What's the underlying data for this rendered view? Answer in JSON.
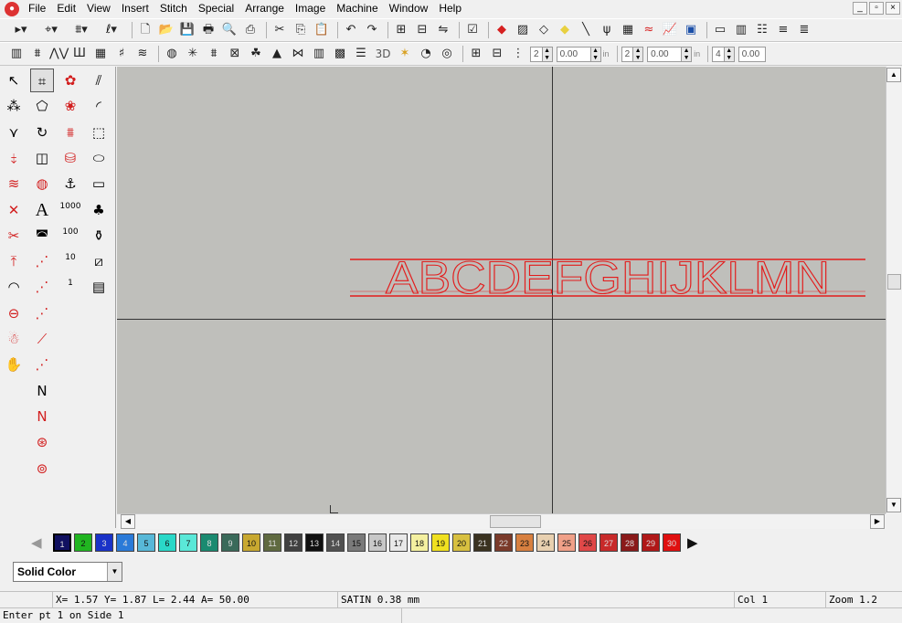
{
  "menubar": {
    "items": [
      "File",
      "Edit",
      "View",
      "Insert",
      "Stitch",
      "Special",
      "Arrange",
      "Image",
      "Machine",
      "Window",
      "Help"
    ]
  },
  "window_controls": {
    "minimize": "_",
    "restore": "▫",
    "close": "×"
  },
  "toolbar1": {
    "tools": [
      {
        "name": "select-mode-icon",
        "glyph": "▸▾"
      },
      {
        "name": "edit-points-icon",
        "glyph": "⌖▾"
      },
      {
        "name": "stitch-mode-icon",
        "glyph": "⩩▾"
      },
      {
        "name": "pen-mode-icon",
        "glyph": "ℓ▾"
      },
      {
        "name": "new-file-icon",
        "glyph": "🗋"
      },
      {
        "name": "open-file-icon",
        "glyph": "📂"
      },
      {
        "name": "save-icon",
        "glyph": "💾"
      },
      {
        "name": "print-icon",
        "glyph": "🖶"
      },
      {
        "name": "print-preview-icon",
        "glyph": "🔍"
      },
      {
        "name": "scan-icon",
        "glyph": "⎙"
      },
      {
        "name": "cut-icon",
        "glyph": "✂"
      },
      {
        "name": "copy-icon",
        "glyph": "⎘"
      },
      {
        "name": "paste-icon",
        "glyph": "📋"
      },
      {
        "name": "undo-icon",
        "glyph": "↶"
      },
      {
        "name": "redo-icon",
        "glyph": "↷"
      },
      {
        "name": "group-icon",
        "glyph": "⊞"
      },
      {
        "name": "ungroup-icon",
        "glyph": "⊟"
      },
      {
        "name": "mirror-icon",
        "glyph": "⇋"
      },
      {
        "name": "checkbox-icon",
        "glyph": "☑"
      },
      {
        "name": "red-fill-icon",
        "glyph": "◆"
      },
      {
        "name": "pattern-fill-icon",
        "glyph": "▨"
      },
      {
        "name": "outline-icon",
        "glyph": "◇"
      },
      {
        "name": "yellow-fill-icon",
        "glyph": "◆"
      },
      {
        "name": "needle-icon",
        "glyph": "╲"
      },
      {
        "name": "satin-icon",
        "glyph": "ψ"
      },
      {
        "name": "grid-icon",
        "glyph": "▦"
      },
      {
        "name": "red-satin-icon",
        "glyph": "≈"
      },
      {
        "name": "chart-icon",
        "glyph": "📈"
      },
      {
        "name": "color-picture-icon",
        "glyph": "▣"
      },
      {
        "name": "monitor-icon",
        "glyph": "▭"
      },
      {
        "name": "columns-icon",
        "glyph": "▥"
      },
      {
        "name": "tree-icon",
        "glyph": "☷"
      },
      {
        "name": "align-left-icon",
        "glyph": "≡"
      },
      {
        "name": "align-right-icon",
        "glyph": "≣"
      }
    ]
  },
  "toolbar2": {
    "stitch_tools": [
      {
        "name": "fill-stitch-icon",
        "glyph": "▥"
      },
      {
        "name": "column-stitch-icon",
        "glyph": "⩩"
      },
      {
        "name": "wave-stitch-icon",
        "glyph": "⋀⋁"
      },
      {
        "name": "satin-column-icon",
        "glyph": "Ш"
      },
      {
        "name": "tatami-icon",
        "glyph": "▦"
      },
      {
        "name": "net-icon",
        "glyph": "♯"
      },
      {
        "name": "motif-icon",
        "glyph": "≋"
      },
      {
        "name": "circle-fill-icon",
        "glyph": "◍"
      },
      {
        "name": "star-fill-icon",
        "glyph": "✳"
      },
      {
        "name": "zigzag-icon",
        "glyph": "⩩"
      },
      {
        "name": "cross-icon",
        "glyph": "⊠"
      },
      {
        "name": "leaf-icon",
        "glyph": "☘"
      },
      {
        "name": "triangle-fill-icon",
        "glyph": "▲"
      },
      {
        "name": "wave-fill-icon",
        "glyph": "⋈"
      },
      {
        "name": "bars-icon",
        "glyph": "▥"
      },
      {
        "name": "block-icon",
        "glyph": "▩"
      },
      {
        "name": "lines-icon",
        "glyph": "☰"
      }
    ],
    "label_3d": "3D",
    "extra_tools": [
      {
        "name": "sparkle-icon",
        "glyph": "✶"
      },
      {
        "name": "shell-icon",
        "glyph": "◔"
      },
      {
        "name": "cup-icon",
        "glyph": "◎"
      },
      {
        "name": "align-grid-icon",
        "glyph": "⊞"
      },
      {
        "name": "align-grid-2-icon",
        "glyph": "⊟"
      },
      {
        "name": "vertical-spacing-icon",
        "glyph": "⋮"
      }
    ],
    "spin1": {
      "value": "2"
    },
    "field1": {
      "value": "0.00",
      "unit": "in"
    },
    "spin2": {
      "value": "2"
    },
    "field2": {
      "value": "0.00",
      "unit": "in"
    },
    "spin3": {
      "value": "4"
    },
    "field3": {
      "value": "0.00"
    }
  },
  "toolbox": {
    "tools": [
      "arrow-select-icon",
      "bezier-select-icon",
      "flower-icon",
      "parallel-lines-icon",
      "node-edit-icon",
      "shape-edit-icon",
      "flower-2-icon",
      "arc-icon",
      "split-icon",
      "rotate-icon",
      "stitches-icon",
      "freeform-icon",
      "cut-stitch-icon",
      "dual-icon",
      "spool-icon",
      "ellipse-icon",
      "stitch-weave-icon",
      "globe-icon",
      "anchor-icon",
      "rectangle-icon",
      "stitch-delete-icon",
      "text-icon",
      "counter-1000-icon",
      "tree-icon",
      "scissors-icon",
      "cap-frame-icon",
      "counter-100-icon",
      "bottles-icon",
      "trim-icon",
      "dotted-line-icon",
      "counter-10-icon",
      "picture-icon",
      "curve-icon",
      "run-stitch-icon",
      "counter-1-icon",
      "sheet-icon",
      "hoop-icon",
      "running-icon",
      "mascot-icon",
      "line-stitch-icon",
      "stop-hand-icon",
      "bean-stitch-icon",
      "node-line-icon",
      "red-node-line-icon",
      "target-icon",
      "wheel-icon"
    ],
    "text_glyph": "A",
    "counters": [
      "1000",
      "100",
      "10",
      "1"
    ]
  },
  "canvas": {
    "lettering_text": "ABCDEFGHIJKLMN",
    "lettering_color": "#e31b1b",
    "background": "#bfbfbb"
  },
  "palette": {
    "swatches": [
      {
        "label": "1",
        "color": "#101060"
      },
      {
        "label": "2",
        "color": "#21b521"
      },
      {
        "label": "3",
        "color": "#1a32c8"
      },
      {
        "label": "4",
        "color": "#2a7ad8"
      },
      {
        "label": "5",
        "color": "#58b8d8"
      },
      {
        "label": "6",
        "color": "#2ad8c8"
      },
      {
        "label": "7",
        "color": "#5ae8d8"
      },
      {
        "label": "8",
        "color": "#1a8a70"
      },
      {
        "label": "9",
        "color": "#3a6a5a"
      },
      {
        "label": "10",
        "color": "#c8a830"
      },
      {
        "label": "11",
        "color": "#606a40"
      },
      {
        "label": "12",
        "color": "#404040"
      },
      {
        "label": "13",
        "color": "#101010"
      },
      {
        "label": "14",
        "color": "#505050"
      },
      {
        "label": "15",
        "color": "#7a7a7a"
      },
      {
        "label": "16",
        "color": "#c8c8c8"
      },
      {
        "label": "17",
        "color": "#e8e8e8"
      },
      {
        "label": "18",
        "color": "#f4f0a0"
      },
      {
        "label": "19",
        "color": "#f0e020"
      },
      {
        "label": "20",
        "color": "#d8c040"
      },
      {
        "label": "21",
        "color": "#3a3220"
      },
      {
        "label": "22",
        "color": "#7a3a2a"
      },
      {
        "label": "23",
        "color": "#d88040"
      },
      {
        "label": "24",
        "color": "#e8d0b0"
      },
      {
        "label": "25",
        "color": "#f0a088"
      },
      {
        "label": "26",
        "color": "#e04848"
      },
      {
        "label": "27",
        "color": "#c82a2a"
      },
      {
        "label": "28",
        "color": "#8a1a1a"
      },
      {
        "label": "29",
        "color": "#b01818"
      },
      {
        "label": "30",
        "color": "#e01010"
      }
    ],
    "prev_glyph": "◀",
    "next_glyph": "▶"
  },
  "color_mode": {
    "value": "Solid Color",
    "arrow": "▼"
  },
  "coords": {
    "text": "X=   1.57 Y=   1.87 L=   2.44 A=  50.00",
    "stitch": "SATIN  0.38 mm",
    "col": "Col 1",
    "zoom": "Zoom 1.2"
  },
  "status": {
    "prompt": "Enter pt 1 on Side 1"
  }
}
